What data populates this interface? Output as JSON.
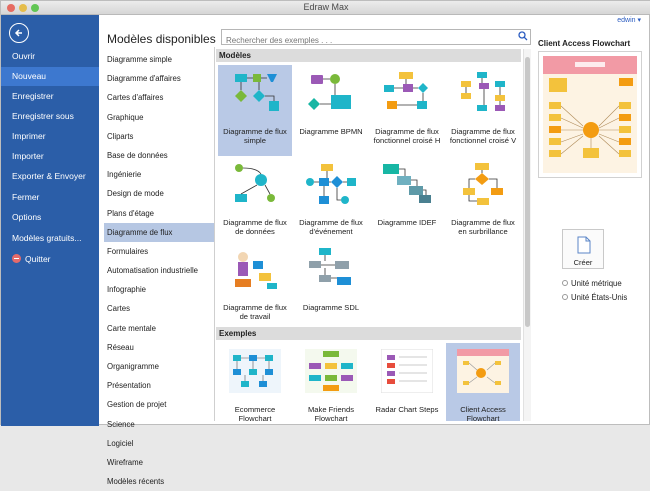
{
  "window": {
    "title": "Edraw Max"
  },
  "user": {
    "name": "edwin"
  },
  "sidebar": {
    "items": [
      "Ouvrir",
      "Nouveau",
      "Enregistrer",
      "Enregistrer sous",
      "Imprimer",
      "Importer",
      "Exporter & Envoyer",
      "Fermer",
      "Options",
      "Modèles gratuits...",
      "Quitter"
    ],
    "active": "Nouveau"
  },
  "main": {
    "heading": "Modèles disponibles",
    "search_placeholder": "Rechercher des exemples . . ."
  },
  "categories": [
    "Diagramme simple",
    "Diagramme d'affaires",
    "Cartes d'affaires",
    "Graphique",
    "Cliparts",
    "Base de données",
    "Ingénierie",
    "Design de mode",
    "Plans d'étage",
    "Diagramme de flux",
    "Formulaires",
    "Automatisation industrielle",
    "Infographie",
    "Cartes",
    "Carte mentale",
    "Réseau",
    "Organigramme",
    "Présentation",
    "Gestion de projet",
    "Science",
    "Logiciel",
    "Wireframe",
    "Modèles récents"
  ],
  "selected_category": "Diagramme de flux",
  "templates_section": "Modèles",
  "templates": [
    "Diagramme de flux simple",
    "Diagramme BPMN",
    "Diagramme de flux fonctionnel croisé H",
    "Diagramme de flux fonctionnel croisé V",
    "Diagramme de flux de données",
    "Diagramme de flux d'événement",
    "Diagramme IDEF",
    "Diagramme de flux en surbrillance",
    "Diagramme de flux de travail",
    "Diagramme SDL"
  ],
  "examples_section": "Exemples",
  "examples": [
    "Ecommerce Flowchart",
    "Make Friends Flowchart",
    "Radar Chart Steps",
    "Client Access Flowchart"
  ],
  "preview": {
    "title": "Client Access Flowchart"
  },
  "create_label": "Créer",
  "units": [
    "Unité métrique",
    "Unité États-Unis"
  ],
  "colors": {
    "sidebar": "#2b5ea8",
    "active": "#3d78cf",
    "selection": "#b6c7e3"
  }
}
